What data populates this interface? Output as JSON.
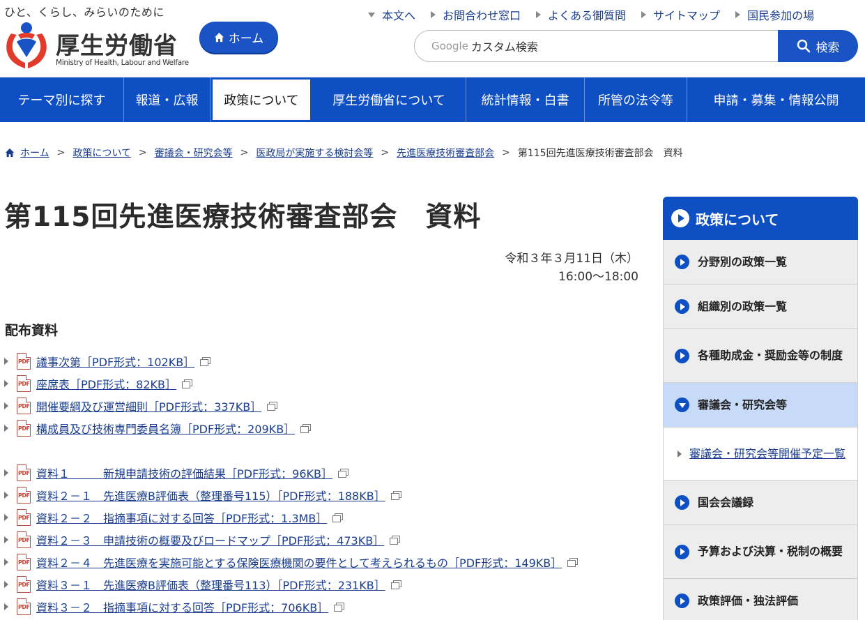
{
  "header": {
    "tagline": "ひと、くらし、みらいのために",
    "logo_name": "厚生労働省",
    "logo_en": "Ministry of Health, Labour and Welfare",
    "home_button": "ホーム",
    "util_links": [
      "本文へ",
      "お問合わせ窓口",
      "よくある御質問",
      "サイトマップ",
      "国民参加の場"
    ],
    "search_brand": "Google",
    "search_placeholder": "カスタム検索",
    "search_button": "検索"
  },
  "global_nav": [
    "テーマ別に探す",
    "報道・広報",
    "政策について",
    "厚生労働省について",
    "統計情報・白書",
    "所管の法令等",
    "申請・募集・情報公開"
  ],
  "global_nav_active": "政策について",
  "breadcrumb": {
    "links": [
      "ホーム",
      "政策について",
      "審議会・研究会等",
      "医政局が実施する検討会等",
      "先進医療技術審査部会"
    ],
    "current": "第115回先進医療技術審査部会　資料"
  },
  "main": {
    "title": "第115回先進医療技術審査部会　資料",
    "date": "令和３年３月11日（木）",
    "time": "16:00～18:00",
    "section_title": "配布資料",
    "pdf_label": "PDF",
    "docs_group1": [
      "議事次第［PDF形式：102KB］",
      "座席表［PDF形式：82KB］",
      "開催要綱及び運営細則［PDF形式：337KB］",
      "構成員及び技術専門委員名簿［PDF形式：209KB］"
    ],
    "docs_group2": [
      "資料１　　　新規申請技術の評価結果［PDF形式：96KB］",
      "資料２－１　先進医療B評価表（整理番号115）［PDF形式：188KB］",
      "資料２－２　指摘事項に対する回答［PDF形式：1.3MB］",
      "資料２－３　申請技術の概要及びロードマップ［PDF形式：473KB］",
      "資料２－４　先進医療を実施可能とする保険医療機関の要件として考えられるもの［PDF形式：149KB］",
      "資料３－１　先進医療B評価表（整理番号113）［PDF形式：231KB］",
      "資料３－２　指摘事項に対する回答［PDF形式：706KB］"
    ]
  },
  "sidebar": {
    "heading": "政策について",
    "items": [
      "分野別の政策一覧",
      "組織別の政策一覧",
      "各種助成金・奨励金等の制度",
      "審議会・研究会等",
      "国会会議録",
      "予算および決算・税制の概要",
      "政策評価・独法評価"
    ],
    "open_item": "審議会・研究会等",
    "sub_items": [
      "審議会・研究会等開催予定一覧"
    ]
  },
  "colors": {
    "primary": "#0e4fc4",
    "link": "#1a3d8f",
    "sidebar_open": "#c7daf7",
    "logo_red": "#e23a2b",
    "logo_blue": "#1a53c4"
  }
}
